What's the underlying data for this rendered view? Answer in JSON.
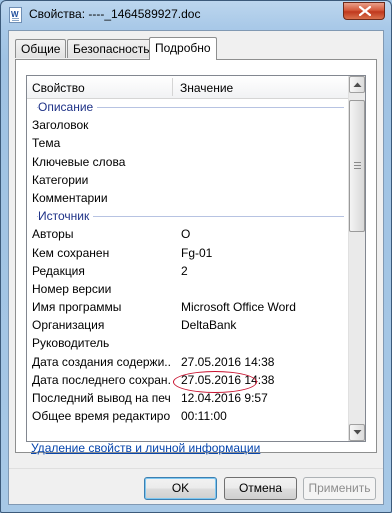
{
  "window": {
    "title": "Свойства: ----_1464589927.doc",
    "app_icon_letter": "W",
    "close_icon": "close-icon"
  },
  "tabs": [
    {
      "label": "Общие",
      "active": false
    },
    {
      "label": "Безопасность",
      "active": false
    },
    {
      "label": "Подробно",
      "active": true
    }
  ],
  "list": {
    "headers": {
      "property": "Свойство",
      "value": "Значение"
    },
    "groups": {
      "description": {
        "title": "Описание",
        "rows": [
          {
            "name": "Заголовок",
            "value": ""
          },
          {
            "name": "Тема",
            "value": ""
          },
          {
            "name": "Ключевые слова",
            "value": ""
          },
          {
            "name": "Категории",
            "value": ""
          },
          {
            "name": "Комментарии",
            "value": ""
          }
        ]
      },
      "source": {
        "title": "Источник",
        "rows": [
          {
            "name": "Авторы",
            "value": "О"
          },
          {
            "name": "Кем сохранен",
            "value": "Fg-01"
          },
          {
            "name": "Редакция",
            "value": "2"
          },
          {
            "name": "Номер версии",
            "value": ""
          },
          {
            "name": "Имя программы",
            "value": "Microsoft Office Word"
          },
          {
            "name": "Организация",
            "value": "DeltaBank"
          },
          {
            "name": "Руководитель",
            "value": ""
          },
          {
            "name": "Дата создания содержи...",
            "value": "27.05.2016 14:38"
          },
          {
            "name": "Дата последнего сохран...",
            "value": "27.05.2016 14:38"
          },
          {
            "name": "Последний вывод на печ...",
            "value": "12.04.2016 9:57"
          },
          {
            "name": "Общее время редактиро...",
            "value": "00:11:00"
          }
        ]
      }
    },
    "highlight_color": "#c8102e"
  },
  "remove_link": "Удаление свойств и личной информации",
  "buttons": {
    "ok": "OK",
    "cancel": "Отмена",
    "apply": "Применить"
  }
}
